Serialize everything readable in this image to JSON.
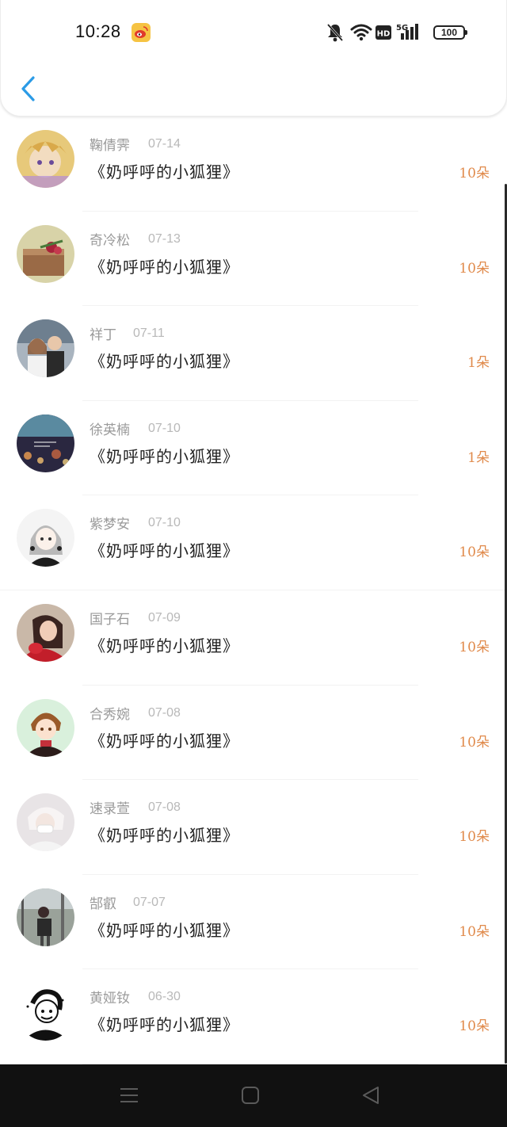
{
  "status_bar": {
    "time": "10:28",
    "battery": "100",
    "icons": [
      "weibo-icon",
      "mute-bell-icon",
      "wifi-icon",
      "hd-icon",
      "signal-5g-icon",
      "battery-icon"
    ]
  },
  "nav": {
    "back_icon": "chevron-left-icon"
  },
  "list": [
    {
      "name": "鞠倩霁",
      "date": "07-14",
      "title": "《奶呼呼的小狐狸》",
      "count": "10朵"
    },
    {
      "name": "奇冷松",
      "date": "07-13",
      "title": "《奶呼呼的小狐狸》",
      "count": "10朵"
    },
    {
      "name": "祥丁",
      "date": "07-11",
      "title": "《奶呼呼的小狐狸》",
      "count": "1朵"
    },
    {
      "name": "徐英楠",
      "date": "07-10",
      "title": "《奶呼呼的小狐狸》",
      "count": "1朵"
    },
    {
      "name": "紫梦安",
      "date": "07-10",
      "title": "《奶呼呼的小狐狸》",
      "count": "10朵"
    },
    {
      "name": "国子石",
      "date": "07-09",
      "title": "《奶呼呼的小狐狸》",
      "count": "10朵"
    },
    {
      "name": "合秀婉",
      "date": "07-08",
      "title": "《奶呼呼的小狐狸》",
      "count": "10朵"
    },
    {
      "name": "速录萱",
      "date": "07-08",
      "title": "《奶呼呼的小狐狸》",
      "count": "10朵"
    },
    {
      "name": "郜叡",
      "date": "07-07",
      "title": "《奶呼呼的小狐狸》",
      "count": "10朵"
    },
    {
      "name": "黄娅钕",
      "date": "06-30",
      "title": "《奶呼呼的小狐狸》",
      "count": "10朵"
    }
  ],
  "bottom_nav": {
    "icons": [
      "menu-icon",
      "home-icon",
      "back-triangle-icon"
    ]
  },
  "colors": {
    "accent": "#2b9be6",
    "count": "#e08a4b",
    "name": "#9a9a9a",
    "date": "#b8b8b8",
    "title": "#222222",
    "navbar": "#111111"
  }
}
